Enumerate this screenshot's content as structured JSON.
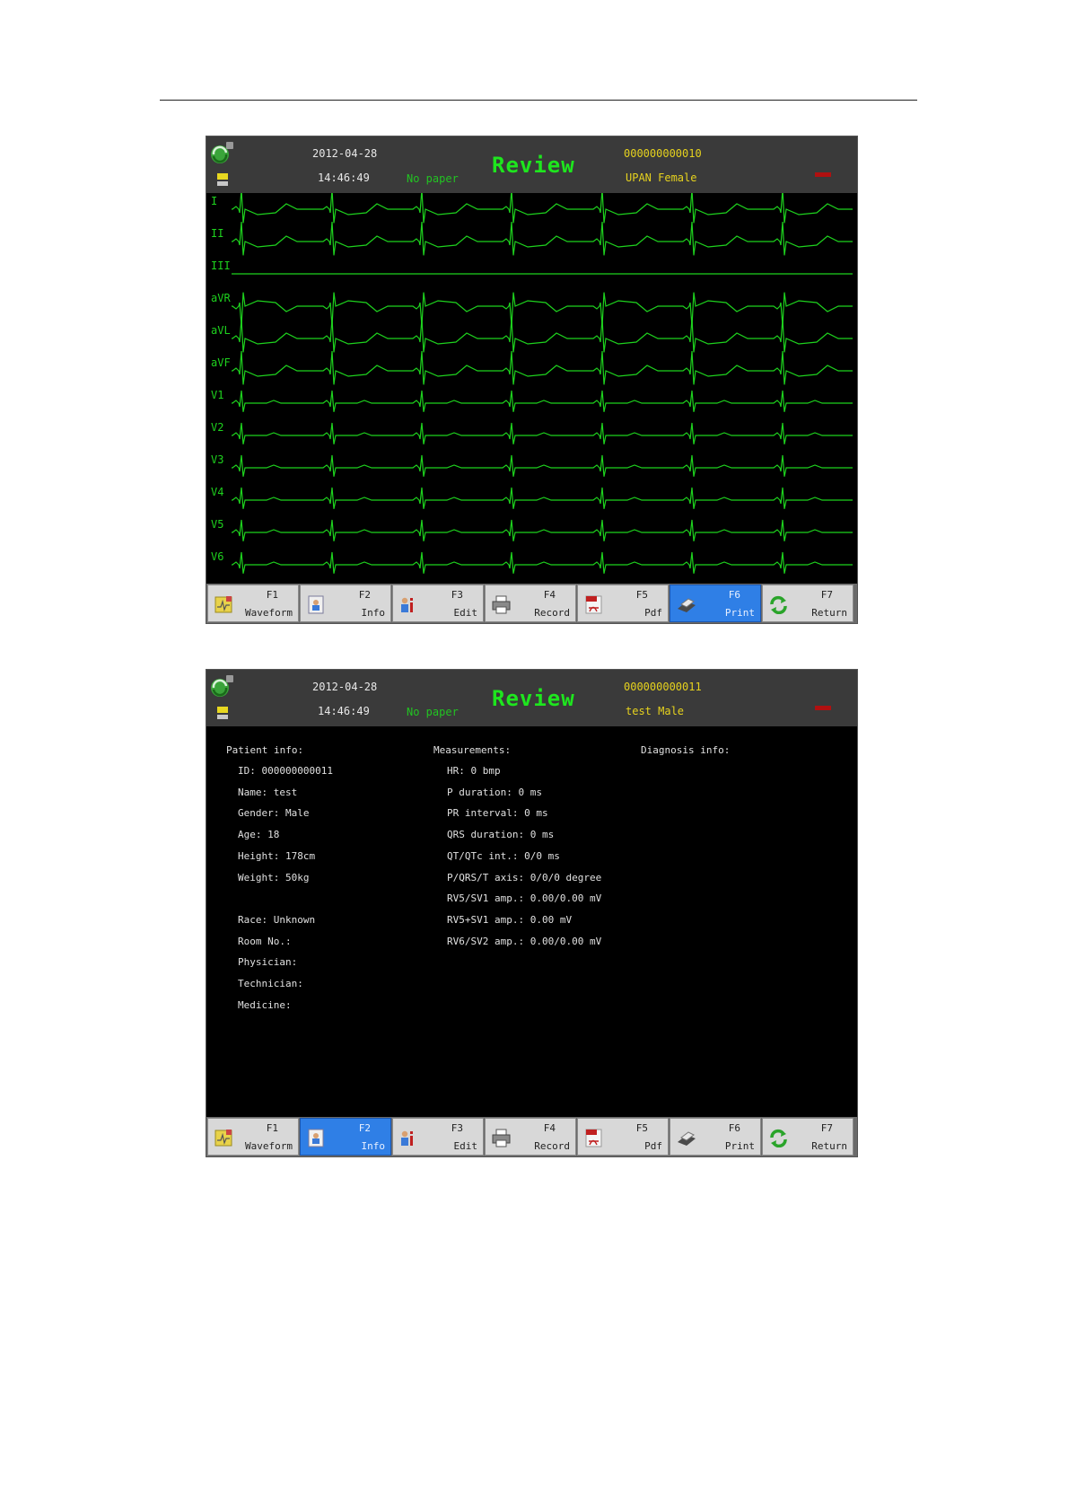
{
  "screen1": {
    "header": {
      "date": "2012-04-28",
      "time": "14:46:49",
      "paper_status": "No paper",
      "title": "Review",
      "patient_id": "000000000010",
      "patient_name_gender": "UPAN Female"
    },
    "leads": [
      "I",
      "II",
      "III",
      "aVR",
      "aVL",
      "aVF",
      "V1",
      "V2",
      "V3",
      "V4",
      "V5",
      "V6"
    ],
    "function_keys": [
      {
        "key": "F1",
        "label": "Waveform",
        "icon": "waveform-icon",
        "active": false
      },
      {
        "key": "F2",
        "label": "Info",
        "icon": "info-icon",
        "active": false
      },
      {
        "key": "F3",
        "label": "Edit",
        "icon": "edit-icon",
        "active": false
      },
      {
        "key": "F4",
        "label": "Record",
        "icon": "printer-icon",
        "active": false
      },
      {
        "key": "F5",
        "label": "Pdf",
        "icon": "pdf-icon",
        "active": false
      },
      {
        "key": "F6",
        "label": "Print",
        "icon": "scanner-icon",
        "active": true
      },
      {
        "key": "F7",
        "label": "Return",
        "icon": "return-icon",
        "active": false
      }
    ]
  },
  "screen2": {
    "header": {
      "date": "2012-04-28",
      "time": "14:46:49",
      "paper_status": "No paper",
      "title": "Review",
      "patient_id": "000000000011",
      "patient_name_gender": "test Male"
    },
    "patient_info": {
      "heading": "Patient info:",
      "rows": [
        "ID: 000000000011",
        "Name: test",
        "Gender: Male",
        "Age: 18",
        "Height: 178cm",
        "Weight: 50kg",
        "",
        "Race: Unknown",
        "Room No.:",
        "Physician:",
        "Technician:",
        "Medicine:"
      ]
    },
    "measurements": {
      "heading": "Measurements:",
      "rows": [
        "HR: 0 bmp",
        "P duration: 0 ms",
        "PR interval: 0 ms",
        "QRS duration: 0 ms",
        "QT/QTc int.: 0/0 ms",
        "P/QRS/T axis: 0/0/0 degree",
        "RV5/SV1 amp.: 0.00/0.00 mV",
        "RV5+SV1 amp.: 0.00 mV",
        "RV6/SV2 amp.: 0.00/0.00 mV"
      ]
    },
    "diagnosis": {
      "heading": "Diagnosis info:"
    },
    "function_keys": [
      {
        "key": "F1",
        "label": "Waveform",
        "icon": "waveform-icon",
        "active": false
      },
      {
        "key": "F2",
        "label": "Info",
        "icon": "info-icon",
        "active": true
      },
      {
        "key": "F3",
        "label": "Edit",
        "icon": "edit-icon",
        "active": false
      },
      {
        "key": "F4",
        "label": "Record",
        "icon": "printer-icon",
        "active": false
      },
      {
        "key": "F5",
        "label": "Pdf",
        "icon": "pdf-icon",
        "active": false
      },
      {
        "key": "F6",
        "label": "Print",
        "icon": "scanner-icon",
        "active": false
      },
      {
        "key": "F7",
        "label": "Return",
        "icon": "return-icon",
        "active": false
      }
    ]
  },
  "colors": {
    "ecg_trace": "#1ed21e",
    "title": "#1ee61e",
    "patient_text": "#e6d21e",
    "active_key": "#2f7fe6"
  }
}
